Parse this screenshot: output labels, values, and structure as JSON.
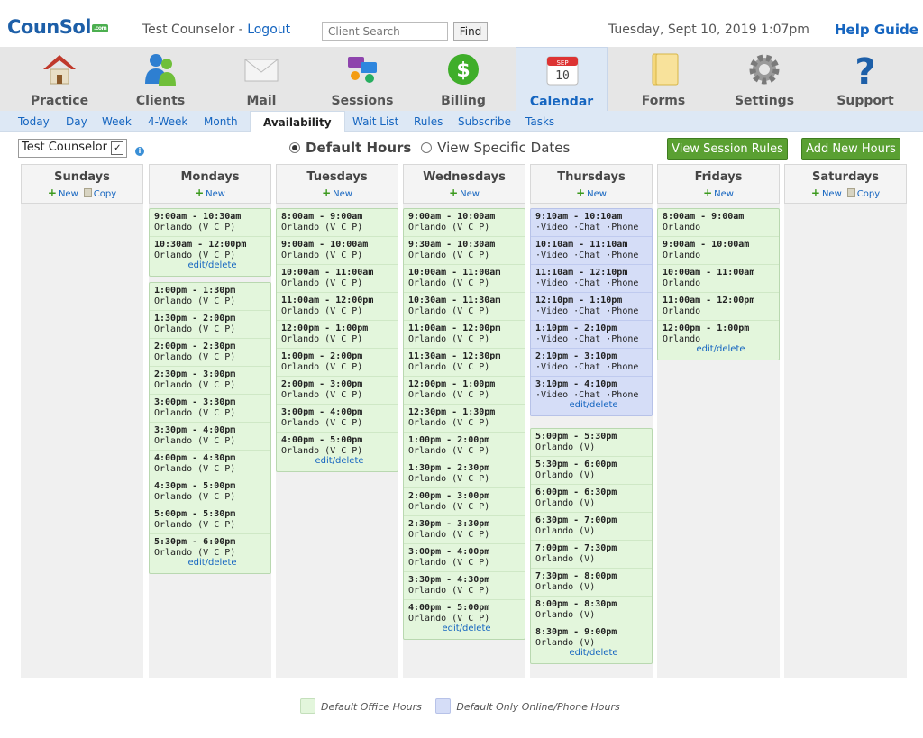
{
  "header": {
    "logo": "CounSol",
    "logo_com": ".com",
    "counselor_name": "Test Counselor - ",
    "logout": "Logout",
    "search_placeholder": "Client Search",
    "find": "Find",
    "datetime": "Tuesday, Sept 10, 2019  1:07pm",
    "help": "Help Guide"
  },
  "nav": {
    "practice": "Practice",
    "clients": "Clients",
    "mail": "Mail",
    "sessions": "Sessions",
    "billing": "Billing",
    "calendar": "Calendar",
    "calendar_month": "SEP",
    "calendar_day": "10",
    "forms": "Forms",
    "settings": "Settings",
    "support": "Support"
  },
  "subnav": {
    "today": "Today",
    "day": "Day",
    "week": "Week",
    "four_week": "4-Week",
    "month": "Month",
    "availability": "Availability",
    "wait_list": "Wait List",
    "rules": "Rules",
    "subscribe": "Subscribe",
    "tasks": "Tasks"
  },
  "toolbar": {
    "counselor_select": "Test Counselor",
    "default_hours": "Default Hours",
    "specific_dates": "View Specific Dates",
    "view_rules": "View Session Rules",
    "add_hours": "Add New Hours"
  },
  "labels": {
    "new": "New",
    "copy": "Copy",
    "edit_delete": "edit/delete"
  },
  "days": {
    "sun": "Sundays",
    "mon": "Mondays",
    "tue": "Tuesdays",
    "wed": "Wednesdays",
    "thu": "Thursdays",
    "fri": "Fridays",
    "sat": "Saturdays"
  },
  "slots": {
    "mon1": [
      {
        "time": "9:00am - 10:30am",
        "loc": "Orlando (V C P)"
      },
      {
        "time": "10:30am - 12:00pm",
        "loc": "Orlando (V C P)"
      }
    ],
    "mon2": [
      {
        "time": "1:00pm - 1:30pm",
        "loc": "Orlando (V C P)"
      },
      {
        "time": "1:30pm - 2:00pm",
        "loc": "Orlando (V C P)"
      },
      {
        "time": "2:00pm - 2:30pm",
        "loc": "Orlando (V C P)"
      },
      {
        "time": "2:30pm - 3:00pm",
        "loc": "Orlando (V C P)"
      },
      {
        "time": "3:00pm - 3:30pm",
        "loc": "Orlando (V C P)"
      },
      {
        "time": "3:30pm - 4:00pm",
        "loc": "Orlando (V C P)"
      },
      {
        "time": "4:00pm - 4:30pm",
        "loc": "Orlando (V C P)"
      },
      {
        "time": "4:30pm - 5:00pm",
        "loc": "Orlando (V C P)"
      },
      {
        "time": "5:00pm - 5:30pm",
        "loc": "Orlando (V C P)"
      },
      {
        "time": "5:30pm - 6:00pm",
        "loc": "Orlando (V C P)"
      }
    ],
    "tue": [
      {
        "time": "8:00am - 9:00am",
        "loc": "Orlando (V C P)"
      },
      {
        "time": "9:00am - 10:00am",
        "loc": "Orlando (V C P)"
      },
      {
        "time": "10:00am - 11:00am",
        "loc": "Orlando (V C P)"
      },
      {
        "time": "11:00am - 12:00pm",
        "loc": "Orlando (V C P)"
      },
      {
        "time": "12:00pm - 1:00pm",
        "loc": "Orlando (V C P)"
      },
      {
        "time": "1:00pm - 2:00pm",
        "loc": "Orlando (V C P)"
      },
      {
        "time": "2:00pm - 3:00pm",
        "loc": "Orlando (V C P)"
      },
      {
        "time": "3:00pm - 4:00pm",
        "loc": "Orlando (V C P)"
      },
      {
        "time": "4:00pm - 5:00pm",
        "loc": "Orlando (V C P)"
      }
    ],
    "wed": [
      {
        "time": "9:00am - 10:00am",
        "loc": "Orlando (V C P)"
      },
      {
        "time": "9:30am - 10:30am",
        "loc": "Orlando (V C P)"
      },
      {
        "time": "10:00am - 11:00am",
        "loc": "Orlando (V C P)"
      },
      {
        "time": "10:30am - 11:30am",
        "loc": "Orlando (V C P)"
      },
      {
        "time": "11:00am - 12:00pm",
        "loc": "Orlando (V C P)"
      },
      {
        "time": "11:30am - 12:30pm",
        "loc": "Orlando (V C P)"
      },
      {
        "time": "12:00pm - 1:00pm",
        "loc": "Orlando (V C P)"
      },
      {
        "time": "12:30pm - 1:30pm",
        "loc": "Orlando (V C P)"
      },
      {
        "time": "1:00pm - 2:00pm",
        "loc": "Orlando (V C P)"
      },
      {
        "time": "1:30pm - 2:30pm",
        "loc": "Orlando (V C P)"
      },
      {
        "time": "2:00pm - 3:00pm",
        "loc": "Orlando (V C P)"
      },
      {
        "time": "2:30pm - 3:30pm",
        "loc": "Orlando (V C P)"
      },
      {
        "time": "3:00pm - 4:00pm",
        "loc": "Orlando (V C P)"
      },
      {
        "time": "3:30pm - 4:30pm",
        "loc": "Orlando (V C P)"
      },
      {
        "time": "4:00pm - 5:00pm",
        "loc": "Orlando (V C P)"
      }
    ],
    "thu1": [
      {
        "time": "9:10am - 10:10am",
        "loc": "·Video ·Chat ·Phone"
      },
      {
        "time": "10:10am - 11:10am",
        "loc": "·Video ·Chat ·Phone"
      },
      {
        "time": "11:10am - 12:10pm",
        "loc": "·Video ·Chat ·Phone"
      },
      {
        "time": "12:10pm - 1:10pm",
        "loc": "·Video ·Chat ·Phone"
      },
      {
        "time": "1:10pm - 2:10pm",
        "loc": "·Video ·Chat ·Phone"
      },
      {
        "time": "2:10pm - 3:10pm",
        "loc": "·Video ·Chat ·Phone"
      },
      {
        "time": "3:10pm - 4:10pm",
        "loc": "·Video ·Chat ·Phone"
      }
    ],
    "thu2": [
      {
        "time": "5:00pm - 5:30pm",
        "loc": "Orlando (V)"
      },
      {
        "time": "5:30pm - 6:00pm",
        "loc": "Orlando (V)"
      },
      {
        "time": "6:00pm - 6:30pm",
        "loc": "Orlando (V)"
      },
      {
        "time": "6:30pm - 7:00pm",
        "loc": "Orlando (V)"
      },
      {
        "time": "7:00pm - 7:30pm",
        "loc": "Orlando (V)"
      },
      {
        "time": "7:30pm - 8:00pm",
        "loc": "Orlando (V)"
      },
      {
        "time": "8:00pm - 8:30pm",
        "loc": "Orlando (V)"
      },
      {
        "time": "8:30pm - 9:00pm",
        "loc": "Orlando (V)"
      }
    ],
    "fri": [
      {
        "time": "8:00am - 9:00am",
        "loc": "Orlando"
      },
      {
        "time": "9:00am - 10:00am",
        "loc": "Orlando"
      },
      {
        "time": "10:00am - 11:00am",
        "loc": "Orlando"
      },
      {
        "time": "11:00am - 12:00pm",
        "loc": "Orlando"
      },
      {
        "time": "12:00pm - 1:00pm",
        "loc": "Orlando"
      }
    ]
  },
  "legend": {
    "office": "Default Office Hours",
    "online": "Default Only Online/Phone Hours"
  },
  "colors": {
    "office_bg": "#e3f6dc",
    "online_bg": "#d5ddf7",
    "link": "#1565c0",
    "button": "#5aa032"
  }
}
